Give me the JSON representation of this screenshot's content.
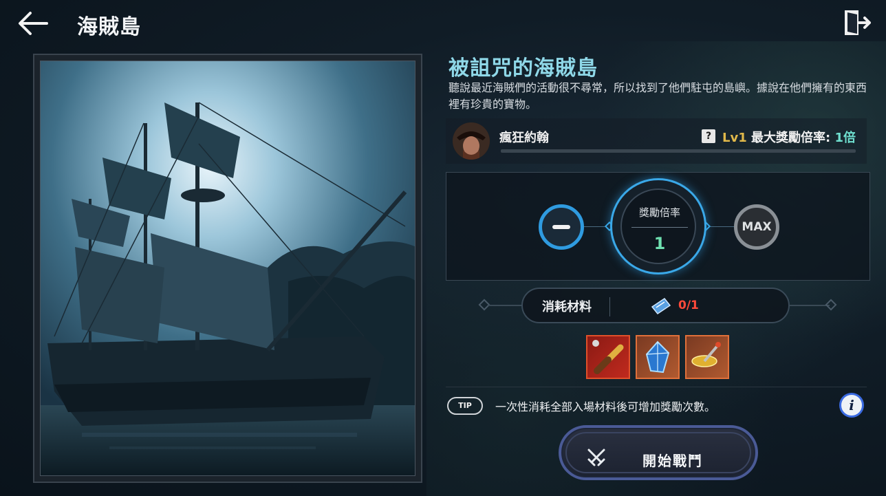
{
  "header": {
    "title": "海賊島",
    "back_icon": "arrow-left-icon",
    "exit_icon": "exit-door-icon"
  },
  "stage": {
    "name": "被詛咒的海賊島",
    "description": "聽說最近海賊們的活動很不尋常，所以找到了他們駐屯的島嶼。據說在他們擁有的東西裡有珍貴的寶物。",
    "image": "pirate-ship-at-night"
  },
  "boss": {
    "name": "瘋狂約翰",
    "help_icon_label": "?",
    "level_label": "Lv1",
    "max_mult_label": "最大獎勵倍率:",
    "max_mult_value": "1倍"
  },
  "multiplier": {
    "label": "獎勵倍率",
    "value": "1",
    "max_label": "MAX"
  },
  "material": {
    "label": "消耗材料",
    "count": "0/1",
    "count_color": "#ff4a3a"
  },
  "reward_items": [
    {
      "name": "spyglass-item"
    },
    {
      "name": "blue-crystal-item"
    },
    {
      "name": "golden-spinner-item"
    }
  ],
  "tip": {
    "badge": "TIP",
    "text": "一次性消耗全部入場材料後可增加獎勵次數。",
    "info_icon_label": "i"
  },
  "start_button": {
    "label": "開始戰鬥"
  },
  "colors": {
    "accent_blue": "#3aa8e8",
    "title_cyan": "#8fd8e8",
    "level_gold": "#e0b84a",
    "mult_teal": "#6fe0d0"
  }
}
